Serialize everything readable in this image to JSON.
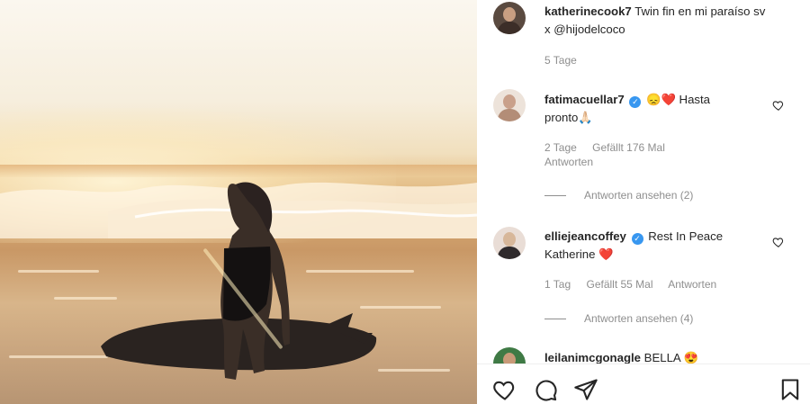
{
  "post": {
    "author": "katherinecook7",
    "caption": "Twin fin en mi paraíso sv x @hijodelcoco",
    "age": "5 Tage"
  },
  "comments": [
    {
      "username": "fatimacuellar7",
      "verified": true,
      "text_line1": "😞❤️ Hasta",
      "text_line2": "pronto🙏🏻",
      "age": "2 Tage",
      "likes": "Gefällt 176 Mal",
      "reply_label": "Antworten",
      "view_replies": "Antworten ansehen (2)"
    },
    {
      "username": "elliejeancoffey",
      "verified": true,
      "text_line1": "Rest In Peace",
      "text_line2": "Katherine ❤️",
      "age": "1 Tag",
      "likes": "Gefällt 55 Mal",
      "reply_label": "Antworten",
      "view_replies": "Antworten ansehen (4)"
    },
    {
      "username": "leilanimcgonagle",
      "text": "BELLA 😍"
    }
  ],
  "icons": {
    "like": "heart-icon",
    "comment": "comment-icon",
    "share": "paper-plane-icon",
    "save": "bookmark-icon"
  },
  "colors": {
    "verified": "#3897f0",
    "text": "#262626",
    "muted": "#8e8e8e",
    "heart_red": "#ed4956"
  }
}
